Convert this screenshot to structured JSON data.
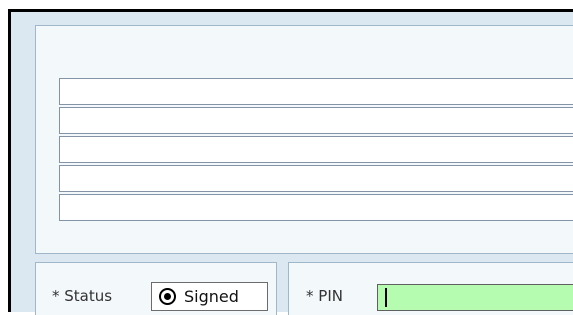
{
  "colors": {
    "window_background": "#dbe8f2",
    "panel_background": "#f3f8fb",
    "panel_border": "#9fb7c8",
    "pin_input_background": "#b5fcb1"
  },
  "text_area": {
    "line_count": 5
  },
  "status": {
    "label": "* Status",
    "option_label": "Signed",
    "selected": true
  },
  "pin": {
    "label": "* PIN",
    "value": ""
  }
}
